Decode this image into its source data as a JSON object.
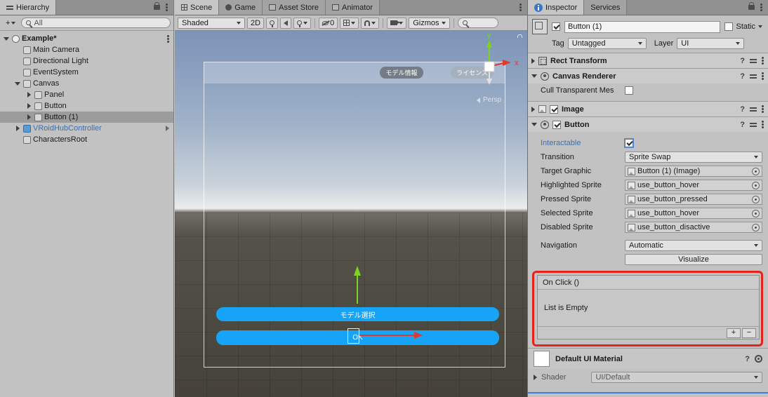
{
  "icons": {
    "help": "?"
  },
  "colors": {
    "button_blue": "#17a3f6",
    "annotation_red": "#e4231a",
    "prefab_text_blue": "#3a6fb0",
    "axis_green": "#7ed321",
    "axis_red": "#e0392e",
    "selection_gray": "#9c9c9c"
  },
  "hierarchy": {
    "tab": "Hierarchy",
    "add_button": "+",
    "search_value": "All",
    "items": [
      {
        "label": "Example*"
      },
      {
        "label": "Main Camera"
      },
      {
        "label": "Directional Light"
      },
      {
        "label": "EventSystem"
      },
      {
        "label": "Canvas"
      },
      {
        "label": "Panel"
      },
      {
        "label": "Button"
      },
      {
        "label": "Button (1)"
      },
      {
        "label": "VRoidHubController"
      },
      {
        "label": "CharactersRoot"
      }
    ]
  },
  "scene": {
    "tabs": [
      {
        "label": "Scene"
      },
      {
        "label": "Game"
      },
      {
        "label": "Asset Store"
      },
      {
        "label": "Animator"
      }
    ],
    "toolbar": {
      "shading": "Shaded",
      "mode_2d": "2D",
      "hidden_count": "0",
      "gizmos": "Gizmos"
    },
    "viewport": {
      "persp": "Persp",
      "axis_x": "x",
      "axis_y": "y",
      "model_info_button": "モデル情報",
      "license_button": "ライセンス",
      "model_select_button": "モデル選択",
      "ok_button": "OK"
    }
  },
  "inspector": {
    "tabs": [
      {
        "label": "Inspector"
      },
      {
        "label": "Services"
      }
    ],
    "header": {
      "name": "Button (1)",
      "static": "Static",
      "tag_label": "Tag",
      "tag_value": "Untagged",
      "layer_label": "Layer",
      "layer_value": "UI"
    },
    "rect_transform": {
      "title": "Rect Transform"
    },
    "canvas_renderer": {
      "title": "Canvas Renderer",
      "cull_label": "Cull Transparent Mes"
    },
    "image": {
      "title": "Image"
    },
    "button": {
      "title": "Button",
      "interactable_label": "Interactable",
      "transition_label": "Transition",
      "transition_value": "Sprite Swap",
      "sprite_rows": [
        {
          "label": "Target Graphic",
          "value": "Button (1) (Image)"
        },
        {
          "label": "Highlighted Sprite",
          "value": "use_button_hover"
        },
        {
          "label": "Pressed Sprite",
          "value": "use_button_pressed"
        },
        {
          "label": "Selected Sprite",
          "value": "use_button_hover"
        },
        {
          "label": "Disabled Sprite",
          "value": "use_button_disactive"
        }
      ],
      "navigation_label": "Navigation",
      "navigation_value": "Automatic",
      "visualize_button": "Visualize"
    },
    "on_click": {
      "title": "On Click ()",
      "empty_text": "List is Empty",
      "add_button": "+",
      "remove_button": "−"
    },
    "material": {
      "title": "Default UI Material",
      "shader_label": "Shader",
      "shader_value": "UI/Default"
    }
  }
}
